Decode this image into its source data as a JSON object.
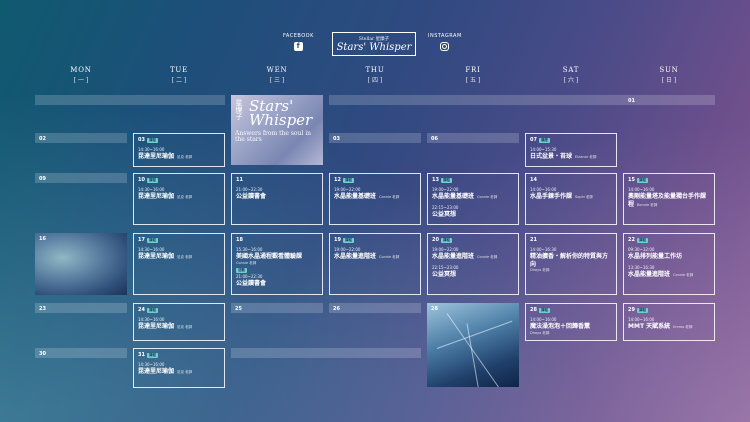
{
  "header": {
    "facebook_label": "FACEBOOK",
    "instagram_label": "INSTAGRAM",
    "logo_small": "Stellar 星爍子",
    "logo_main": "Stars' Whisper"
  },
  "weekdays": [
    {
      "en": "MON",
      "zh": "[ 一 ]"
    },
    {
      "en": "TUE",
      "zh": "[ 二 ]"
    },
    {
      "en": "WEN",
      "zh": "[ 三 ]"
    },
    {
      "en": "THU",
      "zh": "[ 四 ]"
    },
    {
      "en": "FRI",
      "zh": "[ 五 ]"
    },
    {
      "en": "SAT",
      "zh": "[ 六 ]"
    },
    {
      "en": "SUN",
      "zh": "[ 日 ]"
    }
  ],
  "banner": {
    "big": "Stars' Whisper",
    "vertical": "星爍子",
    "sub": "Answers from the soul in the stars"
  },
  "dates": {
    "d01": "01",
    "d02": "02",
    "d03": "03",
    "d06": "06",
    "d09": "09",
    "d16": "16",
    "d23": "23",
    "d25": "25",
    "d26": "26",
    "d30": "30"
  },
  "events": [
    {
      "num": "03",
      "tag": "課程",
      "time": "14:30~16:00",
      "title": "昆達里尼瑜伽",
      "teacher": "尼克 老師"
    },
    {
      "num": "07",
      "tag": "講座",
      "time": "14:00~15:30",
      "title": "日式盆景・苔球",
      "teacher": "Eleanor 老師"
    },
    {
      "num": "10",
      "tag": "課程",
      "time": "14:30~16:00",
      "title": "昆達里尼瑜伽",
      "teacher": "尼克 老師"
    },
    {
      "num": "11",
      "tag": "",
      "time": "21:00~22:30",
      "title": "公益讀書會",
      "teacher": ""
    },
    {
      "num": "12",
      "tag": "課程",
      "time": "19:00~22:00",
      "title": "水晶能量基礎班",
      "teacher": "Connie 老師"
    },
    {
      "num": "13",
      "tag": "課程",
      "time": "19:00~22:00",
      "title": "水晶能量基礎班",
      "teacher": "Connie 老師",
      "time2": "22:15~23:00",
      "title2": "公益冥想"
    },
    {
      "num": "14",
      "tag": "",
      "time": "14:00~16:00",
      "title": "水晶手鍊手作課",
      "teacher": "Sophi 老師"
    },
    {
      "num": "15",
      "tag": "課程",
      "time": "14:00~16:00",
      "title": "奧剛能量塔及能量獨台手作課程",
      "teacher": "Bonnie 老師"
    },
    {
      "num": "17",
      "tag": "課程",
      "time": "14:30~16:00",
      "title": "昆達里尼瑜伽",
      "teacher": "尼克 老師"
    },
    {
      "num": "18",
      "tag": "",
      "time": "15:30~16:00",
      "title": "美國水晶通程觀看體驗課",
      "teacher": "Connie 老師",
      "tag2": "活動",
      "time2": "21:00~22:30",
      "title2": "公益讀書會"
    },
    {
      "num": "19",
      "tag": "課程",
      "time": "19:00~22:00",
      "title": "水晶能量進階班",
      "teacher": "Connie 老師"
    },
    {
      "num": "20",
      "tag": "課程",
      "time": "19:00~22:00",
      "title": "水晶能量進階班",
      "teacher": "Connie 老師",
      "time2": "22:15~23:00",
      "title2": "公益冥想"
    },
    {
      "num": "21",
      "tag": "",
      "time": "14:00~16:30",
      "title": "精油擴香・解析你的特質與方向",
      "teacher": "Dhaya 老師"
    },
    {
      "num": "22",
      "tag": "課程",
      "time": "09:30~12:00",
      "title": "水晶排列能量工作坊",
      "teacher": "",
      "time2": "13:30~16:30",
      "title2": "水晶能量進階班",
      "teacher2": "Connie 老師"
    },
    {
      "num": "24",
      "tag": "課程",
      "time": "14:30~16:00",
      "title": "昆達里尼瑜伽",
      "teacher": "尼克 老師"
    },
    {
      "num": "28",
      "tag": "課程",
      "time": "14:00~16:00",
      "title": "魔法澡泡泡＋回歸香薰",
      "teacher": "Dhaya 老師"
    },
    {
      "num": "29",
      "tag": "課程",
      "time": "14:00~16:00",
      "title": "MMT 天賦系統",
      "teacher": "Emma 老師"
    },
    {
      "num": "31",
      "tag": "課程",
      "time": "14:30~16:00",
      "title": "昆達里尼瑜伽",
      "teacher": "尼克 老師"
    }
  ],
  "colors": {
    "accent_tag": "#6ed0c8"
  }
}
